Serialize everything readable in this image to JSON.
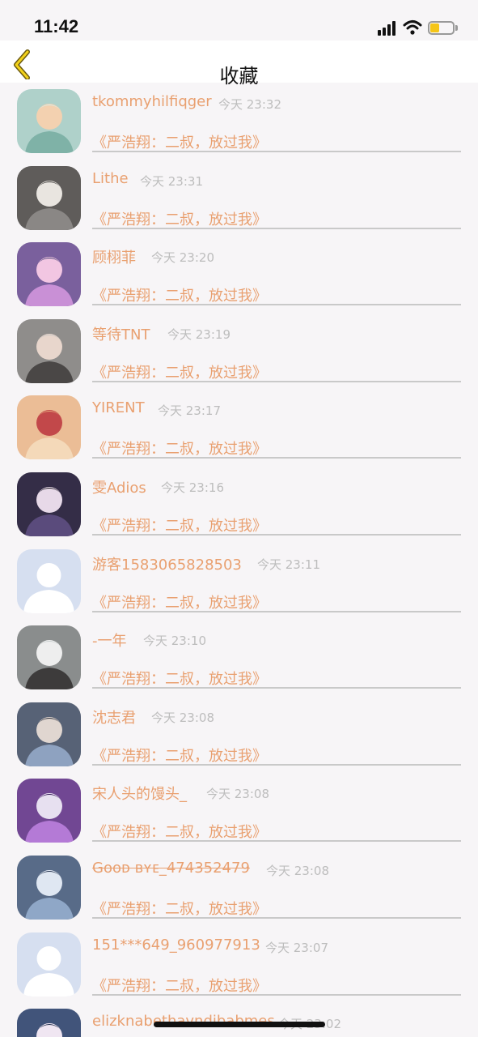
{
  "status_bar": {
    "time": "11:42"
  },
  "nav": {
    "title": "收藏",
    "back_icon": "chevron-left-icon"
  },
  "colors": {
    "accent": "#e9a070",
    "back_icon": "#e6c31a",
    "battery": "#f5c518"
  },
  "items": [
    {
      "name": "tkommyhilfiqger",
      "time": "今天 23:32",
      "book": "《严浩翔：二叔，放过我》"
    },
    {
      "name": "Lithe",
      "time": "今天 23:31",
      "book": "《严浩翔：二叔，放过我》"
    },
    {
      "name": "顾栩菲",
      "time": "今天 23:20",
      "book": "《严浩翔：二叔，放过我》"
    },
    {
      "name": "等待TNT",
      "time": "今天 23:19",
      "book": "《严浩翔：二叔，放过我》"
    },
    {
      "name": "YIRENT",
      "time": "今天 23:17",
      "book": "《严浩翔：二叔，放过我》"
    },
    {
      "name": "雯Adios",
      "time": "今天 23:16",
      "book": "《严浩翔：二叔，放过我》"
    },
    {
      "name": "游客1583065828503",
      "time": "今天 23:11",
      "book": "《严浩翔：二叔，放过我》"
    },
    {
      "name": "-一年",
      "time": "今天 23:10",
      "book": "《严浩翔：二叔，放过我》"
    },
    {
      "name": "沈志君",
      "time": "今天 23:08",
      "book": "《严浩翔：二叔，放过我》"
    },
    {
      "name": "宋人头的馒头_",
      "time": "今天 23:08",
      "book": "《严浩翔：二叔，放过我》"
    },
    {
      "name": "Gᴏᴏᴅ ʙʏᴇ_474352479",
      "time": "今天 23:08",
      "book": "《严浩翔：二叔，放过我》"
    },
    {
      "name": "151***649_960977913",
      "time": "今天 23:07",
      "book": "《严浩翔：二叔，放过我》"
    },
    {
      "name": "elizknabethavndibabmes",
      "time": "今天 23:02",
      "book": ""
    }
  ]
}
